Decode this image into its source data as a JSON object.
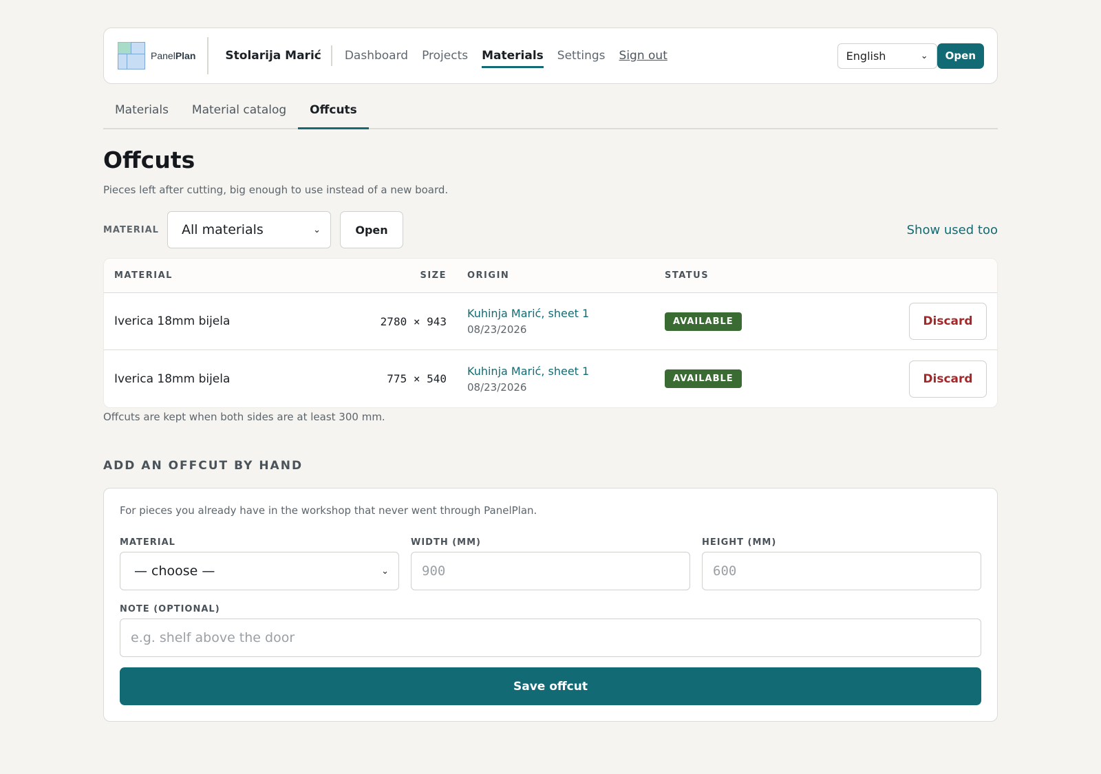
{
  "brand": {
    "logo_text_light": "Panel",
    "logo_text_bold": "Plan",
    "logo_icon": "panel-grid-icon",
    "shop_name": "Stolarija Marić"
  },
  "nav": {
    "items": [
      {
        "label": "Dashboard",
        "active": false
      },
      {
        "label": "Projects",
        "active": false
      },
      {
        "label": "Materials",
        "active": true
      },
      {
        "label": "Settings",
        "active": false
      }
    ],
    "signout_label": "Sign out",
    "language": {
      "selected": "English",
      "open_label": "Open"
    }
  },
  "subtabs": [
    {
      "label": "Materials",
      "active": false
    },
    {
      "label": "Material catalog",
      "active": false
    },
    {
      "label": "Offcuts",
      "active": true
    }
  ],
  "page": {
    "title": "Offcuts",
    "subtitle": "Pieces left after cutting, big enough to use instead of a new board."
  },
  "filter": {
    "label": "MATERIAL",
    "selected": "All materials",
    "open_label": "Open",
    "show_used_label": "Show used too"
  },
  "table": {
    "headers": {
      "material": "MATERIAL",
      "size": "SIZE",
      "origin": "ORIGIN",
      "status": "STATUS"
    },
    "rows": [
      {
        "material": "Iverica 18mm bijela",
        "size": "2780 × 943",
        "origin": "Kuhinja Marić, sheet 1",
        "date": "08/23/2026",
        "status": "AVAILABLE",
        "action": "Discard"
      },
      {
        "material": "Iverica 18mm bijela",
        "size": "775 × 540",
        "origin": "Kuhinja Marić, sheet 1",
        "date": "08/23/2026",
        "status": "AVAILABLE",
        "action": "Discard"
      }
    ],
    "note": "Offcuts are kept when both sides are at least 300 mm."
  },
  "add_form": {
    "heading": "ADD AN OFFCUT BY HAND",
    "intro": "For pieces you already have in the workshop that never went through PanelPlan.",
    "material_label": "MATERIAL",
    "material_selected": "— choose —",
    "width_label": "WIDTH (MM)",
    "width_placeholder": "900",
    "height_label": "HEIGHT (MM)",
    "height_placeholder": "600",
    "note_label": "NOTE (OPTIONAL)",
    "note_placeholder": "e.g. shelf above the door",
    "save_label": "Save offcut"
  },
  "colors": {
    "accent": "#126b74",
    "status_available": "#3a6b32",
    "danger": "#a3282a",
    "background": "#f5f4f0"
  }
}
